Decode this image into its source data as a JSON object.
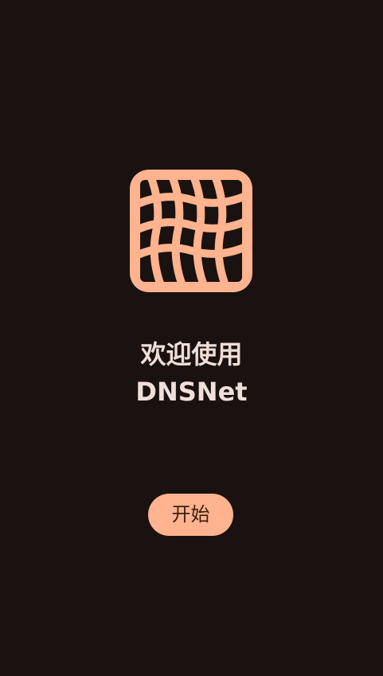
{
  "app": {
    "logo_icon": "dnsnet-net-icon",
    "accent_color": "#ffb38e",
    "background_color": "#1a1210"
  },
  "welcome": {
    "line1": "欢迎使用",
    "line2": "DNSNet"
  },
  "actions": {
    "start_label": "开始"
  }
}
